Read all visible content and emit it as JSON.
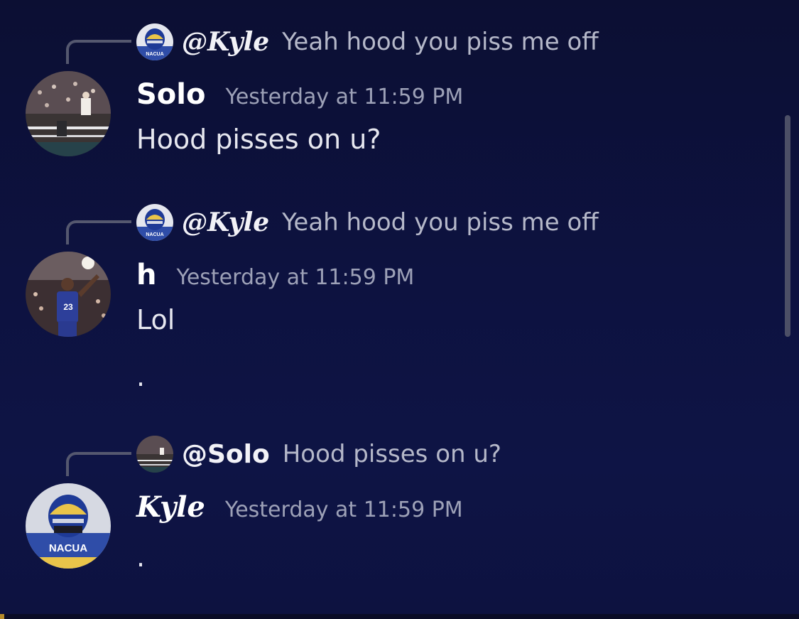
{
  "messages": [
    {
      "reply": {
        "name": "@Kyle",
        "text": "Yeah hood you piss me off",
        "avatar_icon": "helmet-avatar",
        "avatar_text": "NACUA"
      },
      "author": "Solo",
      "avatar_icon": "wrestling-avatar",
      "time": "Yesterday at 11:59 PM",
      "lines": [
        "Hood pisses on u?"
      ]
    },
    {
      "reply": {
        "name": "@Kyle",
        "text": "Yeah hood you piss me off",
        "avatar_icon": "helmet-avatar",
        "avatar_text": "NACUA"
      },
      "author": "h",
      "avatar_icon": "basketball-avatar",
      "avatar_jersey": "23",
      "time": "Yesterday at 11:59 PM",
      "lines": [
        "Lol",
        "."
      ]
    },
    {
      "reply": {
        "name": "@Solo",
        "text": "Hood pisses on u?",
        "avatar_icon": "wrestling-avatar"
      },
      "author": "Kyle",
      "avatar_icon": "helmet-avatar",
      "avatar_text": "NACUA",
      "time": "Yesterday at 11:59 PM",
      "lines": [
        "."
      ]
    }
  ],
  "colors": {
    "background": "#0d1240",
    "timestamp": "#9da1b7",
    "reply_text": "#b5b8c9",
    "spine": "#55586f"
  }
}
